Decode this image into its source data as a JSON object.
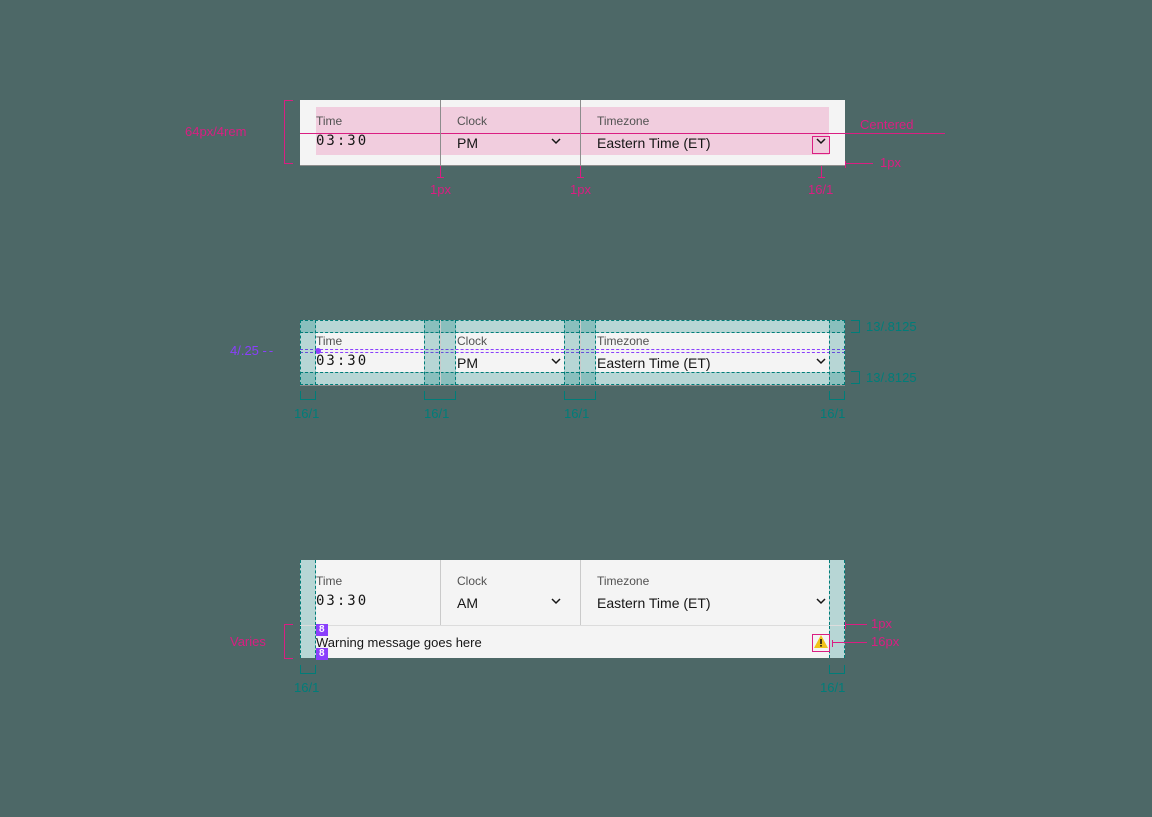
{
  "spec1": {
    "labels": {
      "time": "Time",
      "clock": "Clock",
      "tz": "Timezone"
    },
    "values": {
      "time": "03:30",
      "clock": "PM",
      "tz": "Eastern Time (ET)"
    },
    "ann": {
      "height": "64px/4rem",
      "centered": "Centered",
      "border_right": "1px",
      "divider1": "1px",
      "divider2": "1px",
      "chev": "16/1"
    }
  },
  "spec2": {
    "labels": {
      "time": "Time",
      "clock": "Clock",
      "tz": "Timezone"
    },
    "values": {
      "time": "03:30",
      "clock": "PM",
      "tz": "Eastern Time (ET)"
    },
    "ann": {
      "gap": "4/.25",
      "pad_top": "13/.8125",
      "pad_bottom": "13/.8125",
      "pad_l": "16/1",
      "pad_c1": "16/1",
      "pad_c2": "16/1",
      "pad_r": "16/1"
    }
  },
  "spec3": {
    "labels": {
      "time": "Time",
      "clock": "Clock",
      "tz": "Timezone"
    },
    "values": {
      "time": "03:30",
      "clock": "AM",
      "tz": "Eastern Time (ET)"
    },
    "msg": "Warning message goes here",
    "ann": {
      "varies": "Varies",
      "badge_top": "8",
      "badge_bot": "8",
      "rule": "1px",
      "icon": "16px",
      "pad_l": "16/1",
      "pad_r": "16/1"
    }
  }
}
